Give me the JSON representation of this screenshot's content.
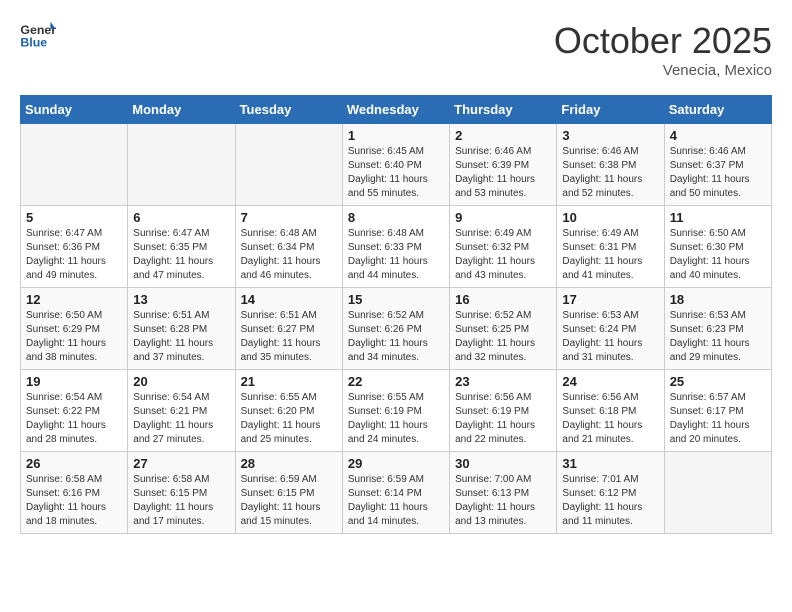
{
  "header": {
    "logo_general": "General",
    "logo_blue": "Blue",
    "month_title": "October 2025",
    "location": "Venecia, Mexico"
  },
  "days_of_week": [
    "Sunday",
    "Monday",
    "Tuesday",
    "Wednesday",
    "Thursday",
    "Friday",
    "Saturday"
  ],
  "weeks": [
    [
      {
        "day": "",
        "info": ""
      },
      {
        "day": "",
        "info": ""
      },
      {
        "day": "",
        "info": ""
      },
      {
        "day": "1",
        "info": "Sunrise: 6:45 AM\nSunset: 6:40 PM\nDaylight: 11 hours and 55 minutes."
      },
      {
        "day": "2",
        "info": "Sunrise: 6:46 AM\nSunset: 6:39 PM\nDaylight: 11 hours and 53 minutes."
      },
      {
        "day": "3",
        "info": "Sunrise: 6:46 AM\nSunset: 6:38 PM\nDaylight: 11 hours and 52 minutes."
      },
      {
        "day": "4",
        "info": "Sunrise: 6:46 AM\nSunset: 6:37 PM\nDaylight: 11 hours and 50 minutes."
      }
    ],
    [
      {
        "day": "5",
        "info": "Sunrise: 6:47 AM\nSunset: 6:36 PM\nDaylight: 11 hours and 49 minutes."
      },
      {
        "day": "6",
        "info": "Sunrise: 6:47 AM\nSunset: 6:35 PM\nDaylight: 11 hours and 47 minutes."
      },
      {
        "day": "7",
        "info": "Sunrise: 6:48 AM\nSunset: 6:34 PM\nDaylight: 11 hours and 46 minutes."
      },
      {
        "day": "8",
        "info": "Sunrise: 6:48 AM\nSunset: 6:33 PM\nDaylight: 11 hours and 44 minutes."
      },
      {
        "day": "9",
        "info": "Sunrise: 6:49 AM\nSunset: 6:32 PM\nDaylight: 11 hours and 43 minutes."
      },
      {
        "day": "10",
        "info": "Sunrise: 6:49 AM\nSunset: 6:31 PM\nDaylight: 11 hours and 41 minutes."
      },
      {
        "day": "11",
        "info": "Sunrise: 6:50 AM\nSunset: 6:30 PM\nDaylight: 11 hours and 40 minutes."
      }
    ],
    [
      {
        "day": "12",
        "info": "Sunrise: 6:50 AM\nSunset: 6:29 PM\nDaylight: 11 hours and 38 minutes."
      },
      {
        "day": "13",
        "info": "Sunrise: 6:51 AM\nSunset: 6:28 PM\nDaylight: 11 hours and 37 minutes."
      },
      {
        "day": "14",
        "info": "Sunrise: 6:51 AM\nSunset: 6:27 PM\nDaylight: 11 hours and 35 minutes."
      },
      {
        "day": "15",
        "info": "Sunrise: 6:52 AM\nSunset: 6:26 PM\nDaylight: 11 hours and 34 minutes."
      },
      {
        "day": "16",
        "info": "Sunrise: 6:52 AM\nSunset: 6:25 PM\nDaylight: 11 hours and 32 minutes."
      },
      {
        "day": "17",
        "info": "Sunrise: 6:53 AM\nSunset: 6:24 PM\nDaylight: 11 hours and 31 minutes."
      },
      {
        "day": "18",
        "info": "Sunrise: 6:53 AM\nSunset: 6:23 PM\nDaylight: 11 hours and 29 minutes."
      }
    ],
    [
      {
        "day": "19",
        "info": "Sunrise: 6:54 AM\nSunset: 6:22 PM\nDaylight: 11 hours and 28 minutes."
      },
      {
        "day": "20",
        "info": "Sunrise: 6:54 AM\nSunset: 6:21 PM\nDaylight: 11 hours and 27 minutes."
      },
      {
        "day": "21",
        "info": "Sunrise: 6:55 AM\nSunset: 6:20 PM\nDaylight: 11 hours and 25 minutes."
      },
      {
        "day": "22",
        "info": "Sunrise: 6:55 AM\nSunset: 6:19 PM\nDaylight: 11 hours and 24 minutes."
      },
      {
        "day": "23",
        "info": "Sunrise: 6:56 AM\nSunset: 6:19 PM\nDaylight: 11 hours and 22 minutes."
      },
      {
        "day": "24",
        "info": "Sunrise: 6:56 AM\nSunset: 6:18 PM\nDaylight: 11 hours and 21 minutes."
      },
      {
        "day": "25",
        "info": "Sunrise: 6:57 AM\nSunset: 6:17 PM\nDaylight: 11 hours and 20 minutes."
      }
    ],
    [
      {
        "day": "26",
        "info": "Sunrise: 6:58 AM\nSunset: 6:16 PM\nDaylight: 11 hours and 18 minutes."
      },
      {
        "day": "27",
        "info": "Sunrise: 6:58 AM\nSunset: 6:15 PM\nDaylight: 11 hours and 17 minutes."
      },
      {
        "day": "28",
        "info": "Sunrise: 6:59 AM\nSunset: 6:15 PM\nDaylight: 11 hours and 15 minutes."
      },
      {
        "day": "29",
        "info": "Sunrise: 6:59 AM\nSunset: 6:14 PM\nDaylight: 11 hours and 14 minutes."
      },
      {
        "day": "30",
        "info": "Sunrise: 7:00 AM\nSunset: 6:13 PM\nDaylight: 11 hours and 13 minutes."
      },
      {
        "day": "31",
        "info": "Sunrise: 7:01 AM\nSunset: 6:12 PM\nDaylight: 11 hours and 11 minutes."
      },
      {
        "day": "",
        "info": ""
      }
    ]
  ]
}
